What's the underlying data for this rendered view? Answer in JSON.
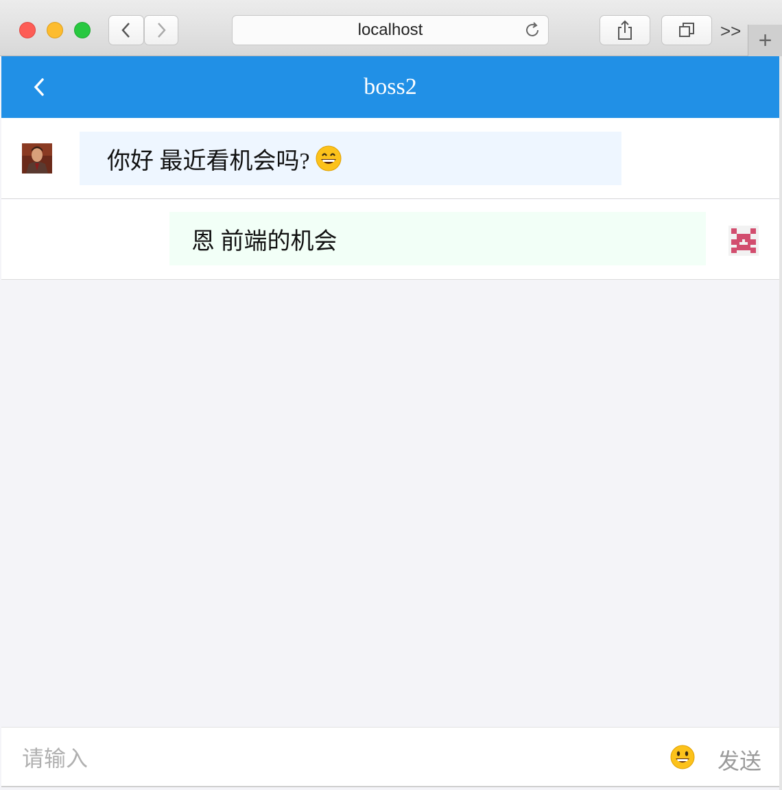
{
  "browser": {
    "url": "localhost",
    "overflow_label": ">>",
    "new_tab_label": "+"
  },
  "header": {
    "title": "boss2"
  },
  "messages": [
    {
      "direction": "incoming",
      "text": "你好 最近看机会吗?",
      "emoji": "grinning-face"
    },
    {
      "direction": "outgoing",
      "text": "恩 前端的机会"
    }
  ],
  "composer": {
    "placeholder": "请输入",
    "send_label": "发送",
    "emoji_icon": "smiley-icon"
  },
  "colors": {
    "header_bg": "#2190e6",
    "incoming_bubble": "#eef6ff",
    "outgoing_bubble": "#f2fff7"
  }
}
